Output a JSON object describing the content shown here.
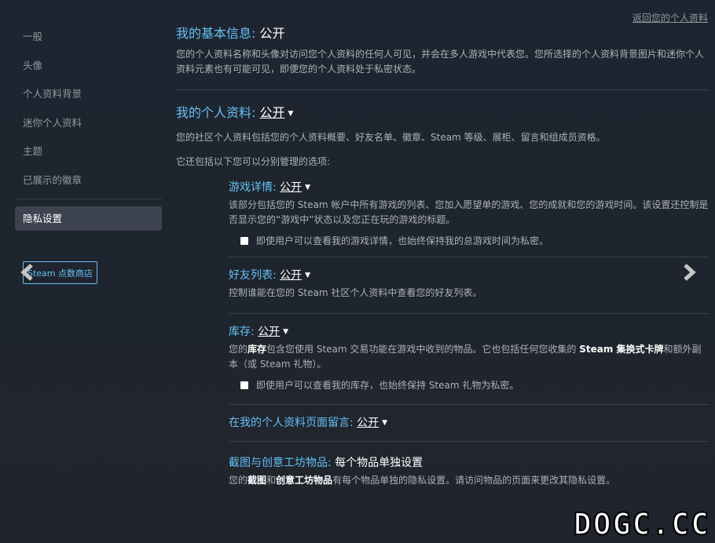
{
  "header": {
    "back_link": "返回您的个人资料"
  },
  "sidebar": {
    "items": [
      {
        "label": "一般"
      },
      {
        "label": "头像"
      },
      {
        "label": "个人资料背景"
      },
      {
        "label": "迷你个人资料"
      },
      {
        "label": "主题"
      },
      {
        "label": "已展示的徽章"
      }
    ],
    "active_item": "隐私设置",
    "store_button": "Steam 点数商店"
  },
  "sections": {
    "basic": {
      "title": "我的基本信息:",
      "value": "公开",
      "description": "您的个人资料名称和头像对访问您个人资料的任何人可见，并会在多人游戏中代表您。您所选择的个人资料背景图片和迷你个人资料元素也有可能可见，即便您的个人资料处于私密状态。"
    },
    "profile": {
      "title": "我的个人资料:",
      "value": "公开",
      "description": "您的社区个人资料包括您的个人资料概要、好友名单、徽章、Steam 等级、展柜、留言和组成员资格。",
      "description2": "它还包括以下您可以分别管理的选项:"
    },
    "game_details": {
      "title": "游戏详情:",
      "value": "公开",
      "description": "该部分包括您的 Steam 帐户中所有游戏的列表、您加入愿望单的游戏、您的成就和您的游戏时间。该设置还控制是否显示您的“游戏中”状态以及您正在玩的游戏的标题。",
      "checkbox": "即使用户可以查看我的游戏详情，也始终保持我的总游戏时间为私密。"
    },
    "friends": {
      "title": "好友列表:",
      "value": "公开",
      "description": "控制谁能在您的 Steam 社区个人资料中查看您的好友列表。"
    },
    "inventory": {
      "title": "库存:",
      "value": "公开",
      "desc_a": "您的",
      "desc_b": "库存",
      "desc_c": "包含您使用 Steam 交易功能在游戏中收到的物品。它也包括任何您收集的 ",
      "desc_d": "Steam 集换式卡牌",
      "desc_e": "和额外副本（或 Steam 礼物）。",
      "checkbox": "即使用户可以查看我的库存，也始终保持 Steam 礼物为私密。"
    },
    "comments": {
      "title": "在我的个人资料页面留言:",
      "value": "公开"
    },
    "screenshots": {
      "title": "截图与创意工坊物品:",
      "value": "每个物品单独设置",
      "desc_a": "您的",
      "desc_b": "截图",
      "desc_c": "和",
      "desc_d": "创意工坊物品",
      "desc_e": "有每个物品单独的隐私设置。请访问物品的页面来更改其隐私设置。"
    }
  },
  "watermark": "DOGC.CC"
}
